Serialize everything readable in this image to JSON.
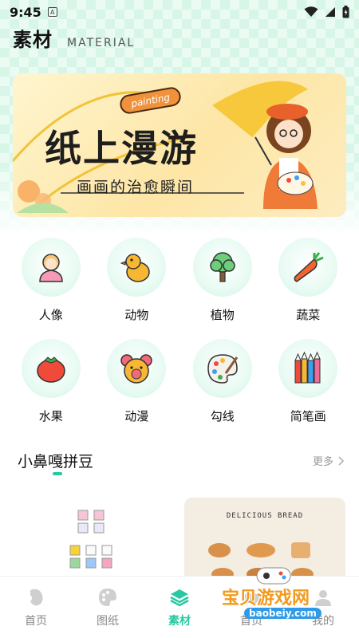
{
  "status_bar": {
    "time": "9:45",
    "notification_glyph": "A"
  },
  "header": {
    "title": "素材",
    "subtitle": "MATERIAL"
  },
  "banner": {
    "tag": "painting",
    "title": "纸上漫游",
    "subtitle": "画画的治愈瞬间"
  },
  "categories": [
    {
      "label": "人像",
      "icon": "portrait-icon"
    },
    {
      "label": "动物",
      "icon": "chick-icon"
    },
    {
      "label": "植物",
      "icon": "tree-icon"
    },
    {
      "label": "蔬菜",
      "icon": "carrot-icon"
    },
    {
      "label": "水果",
      "icon": "tomato-icon"
    },
    {
      "label": "动漫",
      "icon": "bear-icon"
    },
    {
      "label": "勾线",
      "icon": "palette-icon"
    },
    {
      "label": "简笔画",
      "icon": "crayons-icon"
    }
  ],
  "section": {
    "title": "小鼻嘎拼豆",
    "more": "更多"
  },
  "cards": {
    "bread_title": "DELICIOUS BREAD"
  },
  "tabs": [
    {
      "label": "首页",
      "icon": "bean-icon",
      "active": false
    },
    {
      "label": "图纸",
      "icon": "palette-icon",
      "active": false
    },
    {
      "label": "素材",
      "icon": "layers-icon",
      "active": true
    },
    {
      "label": "首页",
      "icon": "game-icon",
      "active": false
    },
    {
      "label": "我的",
      "icon": "user-icon",
      "active": false
    }
  ],
  "watermark": {
    "text": "宝贝游戏网",
    "url": "baobeiy.com"
  },
  "colors": {
    "accent": "#27c8a3",
    "banner_orange": "#f0923c"
  }
}
